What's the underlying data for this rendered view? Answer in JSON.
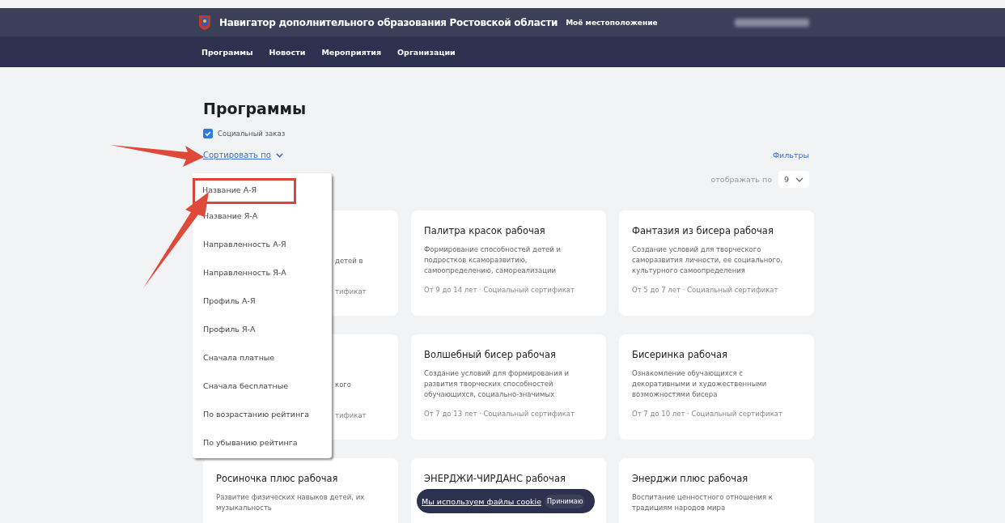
{
  "header": {
    "title": "Навигатор дополнительного образования Ростовской области",
    "location": "Моё местоположение"
  },
  "nav": [
    {
      "label": "Программы"
    },
    {
      "label": "Новости"
    },
    {
      "label": "Мероприятия"
    },
    {
      "label": "Организации"
    }
  ],
  "page_title": "Программы",
  "social_order": {
    "label": "Социальный заказ",
    "checked": true
  },
  "sort": {
    "label": "Сортировать по",
    "expanded": true,
    "options": [
      {
        "label": "Название А-Я",
        "selected": true
      },
      {
        "label": "Название Я-А",
        "selected": false
      },
      {
        "label": "Направленность А-Я",
        "selected": false
      },
      {
        "label": "Направленность Я-А",
        "selected": false
      },
      {
        "label": "Профиль А-Я",
        "selected": false
      },
      {
        "label": "Профиль Я-А",
        "selected": false
      },
      {
        "label": "Сначала платные",
        "selected": false
      },
      {
        "label": "Сначала бесплатные",
        "selected": false
      },
      {
        "label": "По возрастанию рейтинга",
        "selected": false
      },
      {
        "label": "По убыванию рейтинга",
        "selected": false
      }
    ]
  },
  "filters": "Фильтры",
  "per_page": {
    "label": "отображать по",
    "value": "9"
  },
  "cards": [
    {
      "kind": "covered",
      "description": "детей в",
      "meta": "тификат"
    },
    {
      "kind": "full",
      "title": "Палитра красок рабочая",
      "description": "Формирование способностей детей и подростков ксаморазвитию, самоопределению, самореализации",
      "meta": "От 9 до 14 лет · Социальный сертификат"
    },
    {
      "kind": "full",
      "title": "Фантазия из бисера рабочая",
      "description": "Создание условий для творческого саморазвития личности, ее социального, культурного самоопределения",
      "meta": "От 5 до 7 лет · Социальный сертификат"
    },
    {
      "kind": "covered",
      "description": "кого",
      "meta": "тификат"
    },
    {
      "kind": "full",
      "title": "Волшебный бисер рабочая",
      "description": "Создание условий для формирования и развития творческих способностей обучающихся, социально-значимых",
      "meta": "От 7 до 13 лет · Социальный сертификат"
    },
    {
      "kind": "full",
      "title": "Бисеринка рабочая",
      "description": "Ознакомление обучающихся с декоративными и художественными возможностями бисера",
      "meta": "От 7 до 10 лет · Социальный сертификат"
    },
    {
      "kind": "full",
      "title": "Росиночка плюс рабочая",
      "description": "Развитие физических навыков детей, их музыкальность"
    },
    {
      "kind": "full",
      "title": "ЭНЕРДЖИ-ЧИРДАНС рабочая"
    },
    {
      "kind": "full",
      "title": "Энерджи плюс рабочая",
      "description": "Воспитание ценностного отношения к традициям народов мира"
    }
  ],
  "cookie": {
    "text": "Мы используем файлы cookie",
    "button": "Принимаю"
  }
}
